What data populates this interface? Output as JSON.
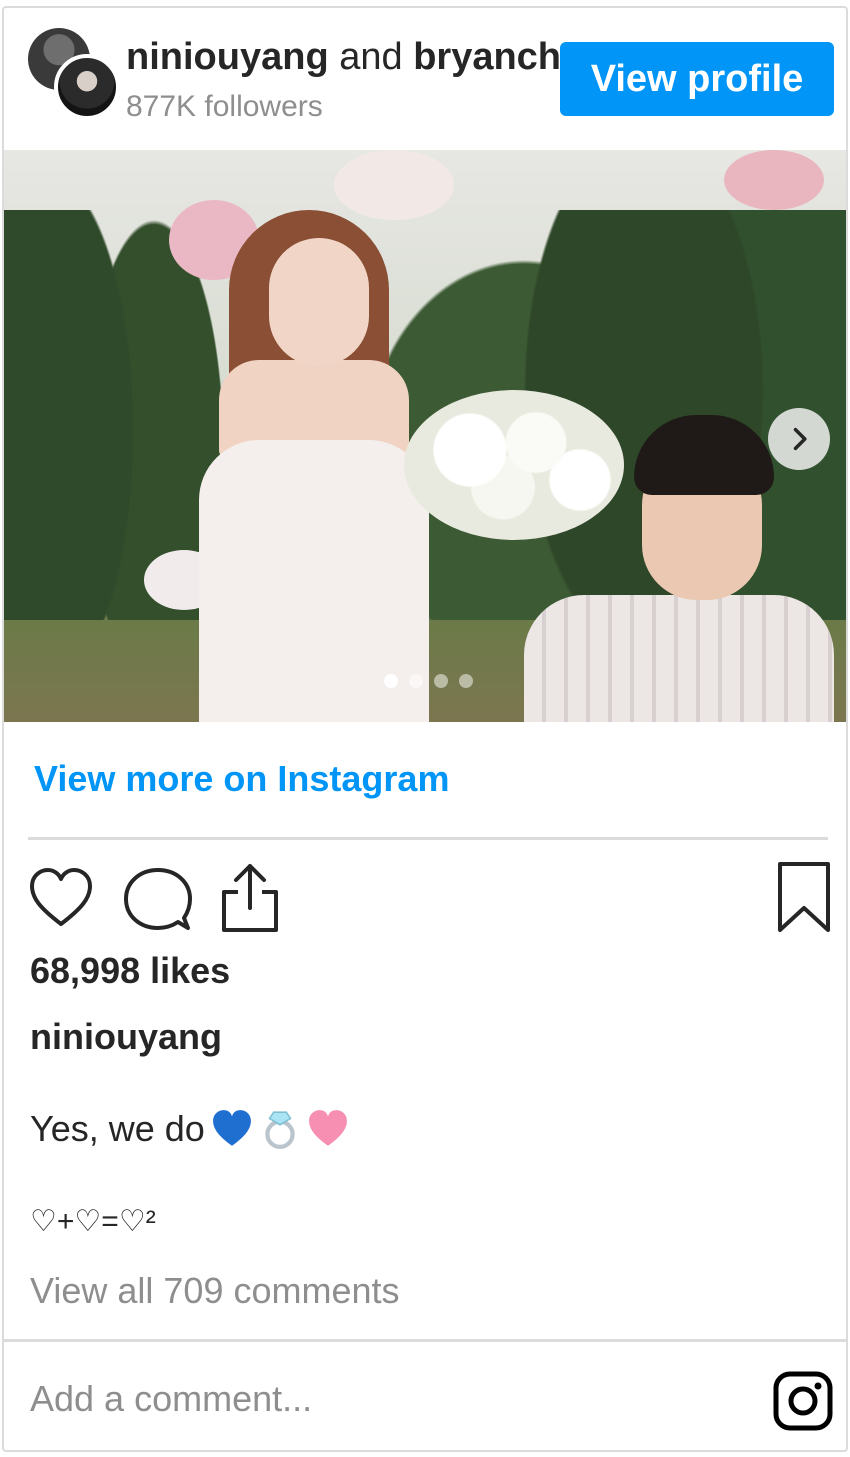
{
  "header": {
    "user1": "niniouyang",
    "conjunction": "and",
    "user2": "bryanch",
    "followers": "877K followers",
    "view_profile_label": "View profile"
  },
  "carousel": {
    "dot_count": 4,
    "active_index": 0
  },
  "view_more_label": "View more on Instagram",
  "post": {
    "likes": "68,998 likes",
    "caption_user": "niniouyang",
    "caption_text": "Yes, we do",
    "caption_emojis": [
      "blue-heart-icon",
      "ring-icon",
      "pink-heart-icon"
    ],
    "caption_line2": "♡+♡=♡²",
    "view_comments": "View all 709 comments"
  },
  "comment_box": {
    "placeholder": "Add a comment..."
  },
  "colors": {
    "accent": "#0095f6",
    "text": "#262626",
    "muted": "#8e8e8e",
    "border": "#dbdbdb"
  }
}
